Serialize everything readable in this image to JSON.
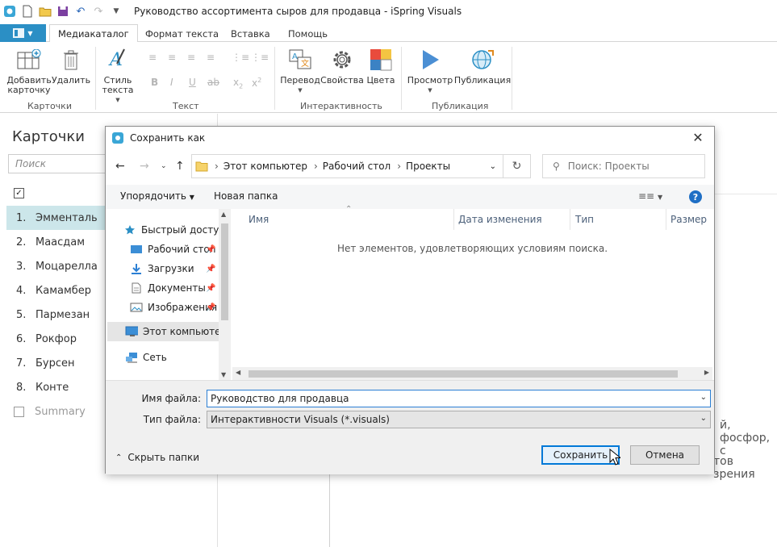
{
  "app": {
    "title": "Руководство ассортимента сыров для продавца - iSpring Visuals"
  },
  "ribbon": {
    "tabs": [
      "Медиакаталог",
      "Формат текста",
      "Вставка",
      "Помощь"
    ],
    "buttons": {
      "add_card": "Добавить карточку",
      "delete_card": "Удалить",
      "style_text": "Стиль текста",
      "translate": "Перевод",
      "properties": "Свойства",
      "colors": "Цвета",
      "preview": "Просмотр",
      "publish": "Публикация"
    },
    "groups": {
      "cards": "Карточки",
      "text": "Текст",
      "interactivity": "Интерактивность",
      "publishing": "Публикация"
    }
  },
  "sidebar": {
    "title": "Карточки",
    "search_placeholder": "Поиск",
    "items": [
      {
        "num": "1.",
        "label": "Эмменталь"
      },
      {
        "num": "2.",
        "label": "Маасдам"
      },
      {
        "num": "3.",
        "label": "Моцарелла"
      },
      {
        "num": "4.",
        "label": "Камамбер"
      },
      {
        "num": "5.",
        "label": "Пармезан"
      },
      {
        "num": "6.",
        "label": "Рокфор"
      },
      {
        "num": "7.",
        "label": "Бурсен"
      },
      {
        "num": "8.",
        "label": "Конте"
      }
    ],
    "summary": "Summary"
  },
  "main": {
    "text1": "й, фосфор, с",
    "text2": "тов зрения"
  },
  "dialog": {
    "title": "Сохранить как",
    "breadcrumb": [
      "Этот компьютер",
      "Рабочий стол",
      "Проекты"
    ],
    "search_placeholder": "Поиск: Проекты",
    "toolbar": {
      "organize": "Упорядочить",
      "new_folder": "Новая папка"
    },
    "nav": [
      {
        "label": "Быстрый доступ",
        "icon": "star-icon"
      },
      {
        "label": "Рабочий стол",
        "icon": "desktop-icon"
      },
      {
        "label": "Загрузки",
        "icon": "download-icon"
      },
      {
        "label": "Документы",
        "icon": "document-icon"
      },
      {
        "label": "Изображения",
        "icon": "image-icon"
      },
      {
        "label": "Этот компьютер",
        "icon": "computer-icon"
      },
      {
        "label": "Сеть",
        "icon": "network-icon"
      }
    ],
    "columns": [
      "Имя",
      "Дата изменения",
      "Тип",
      "Размер"
    ],
    "empty_text": "Нет элементов, удовлетворяющих условиям поиска.",
    "filename_label": "Имя файла:",
    "filename_value": "Руководство для продавца",
    "filetype_label": "Тип файла:",
    "filetype_value": "Интерактивности Visuals (*.visuals)",
    "hide_folders": "Скрыть папки",
    "save_button": "Сохранить",
    "cancel_button": "Отмена"
  },
  "colors": {
    "accent": "#2b8fc5",
    "selection": "#cce6ea",
    "primary_border": "#0078d7"
  }
}
